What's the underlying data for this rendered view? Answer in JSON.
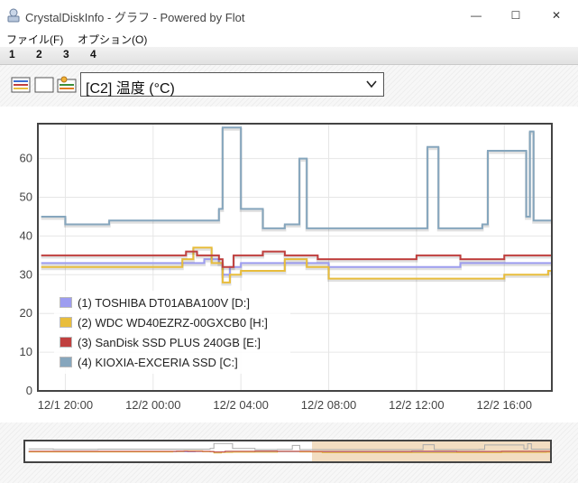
{
  "window": {
    "title": "CrystalDiskInfo - グラフ - Powered by Flot",
    "min_glyph": "—",
    "max_glyph": "☐",
    "close_glyph": "✕"
  },
  "menu": [
    "ファイル(F)",
    "オプション(O)"
  ],
  "tabs": [
    "1",
    "2",
    "3",
    "4"
  ],
  "toolbar": {
    "icons": [
      "multi-graph-icon",
      "blank-graph-icon",
      "settings-graph-icon"
    ],
    "selector_value": "[C2] 温度 (°C)"
  },
  "colors": {
    "series1": "#9d9df0",
    "series2": "#e8bd3c",
    "series3": "#c0403f",
    "series4": "#86a6bd",
    "overview_selection": "#f0d7b6"
  },
  "chart_data": {
    "type": "line",
    "title": "",
    "xlabel": "",
    "ylabel": "",
    "x_ticks": [
      "12/1 20:00",
      "12/2 00:00",
      "12/2 04:00",
      "12/2 08:00",
      "12/2 12:00",
      "12/2 16:00"
    ],
    "y_ticks": [
      0,
      10,
      20,
      30,
      40,
      50,
      60
    ],
    "xlim": [
      "12/1 18:45",
      "12/2 18:10"
    ],
    "ylim": [
      0,
      69
    ],
    "grid": true,
    "legend_position": "bottom-left",
    "series": [
      {
        "name": "(1) TOSHIBA DT01ABA100V [D:]",
        "x": [
          "12/1 18:54",
          "12/2 01:40",
          "12/2 02:20",
          "12/2 03:00",
          "12/2 03:10",
          "12/2 03:30",
          "12/2 04:00",
          "12/2 05:00",
          "12/2 06:00",
          "12/2 08:00",
          "12/2 10:00",
          "12/2 12:00",
          "12/2 14:00",
          "12/2 16:00",
          "12/2 18:00"
        ],
        "values": [
          33,
          33,
          34,
          33,
          30,
          32,
          33,
          33,
          33,
          32,
          32,
          32,
          33,
          33,
          33
        ]
      },
      {
        "name": "(2) WDC WD40EZRZ-00GXCB0 [H:]",
        "x": [
          "12/1 18:54",
          "12/2 00:30",
          "12/2 01:20",
          "12/2 01:50",
          "12/2 02:40",
          "12/2 03:10",
          "12/2 03:30",
          "12/2 04:00",
          "12/2 05:00",
          "12/2 06:00",
          "12/2 07:00",
          "12/2 08:00",
          "12/2 12:00",
          "12/2 16:00",
          "12/2 18:00"
        ],
        "values": [
          32,
          32,
          34,
          37,
          33,
          28,
          30,
          31,
          31,
          34,
          32,
          29,
          29,
          30,
          31
        ]
      },
      {
        "name": "(3) SanDisk SSD PLUS 240GB [E:]",
        "x": [
          "12/1 18:54",
          "12/2 00:00",
          "12/2 01:30",
          "12/2 02:00",
          "12/2 03:00",
          "12/2 03:10",
          "12/2 03:40",
          "12/2 05:00",
          "12/2 06:00",
          "12/2 07:30",
          "12/2 10:00",
          "12/2 12:00",
          "12/2 14:00",
          "12/2 16:00",
          "12/2 18:00"
        ],
        "values": [
          35,
          35,
          36,
          35,
          34,
          32,
          35,
          36,
          35,
          34,
          34,
          35,
          34,
          35,
          35
        ]
      },
      {
        "name": "(4) KIOXIA-EXCERIA SSD [C:]",
        "x": [
          "12/1 18:54",
          "12/1 20:00",
          "12/1 22:00",
          "12/2 00:00",
          "12/2 02:00",
          "12/2 03:00",
          "12/2 03:10",
          "12/2 04:00",
          "12/2 05:00",
          "12/2 06:00",
          "12/2 06:40",
          "12/2 07:00",
          "12/2 09:00",
          "12/2 12:00",
          "12/2 12:30",
          "12/2 13:00",
          "12/2 15:00",
          "12/2 15:15",
          "12/2 17:00",
          "12/2 17:10",
          "12/2 17:20",
          "12/2 18:00"
        ],
        "values": [
          45,
          43,
          44,
          44,
          44,
          47,
          68,
          47,
          42,
          43,
          60,
          42,
          42,
          42,
          63,
          42,
          43,
          62,
          45,
          67,
          44,
          44
        ]
      }
    ]
  }
}
